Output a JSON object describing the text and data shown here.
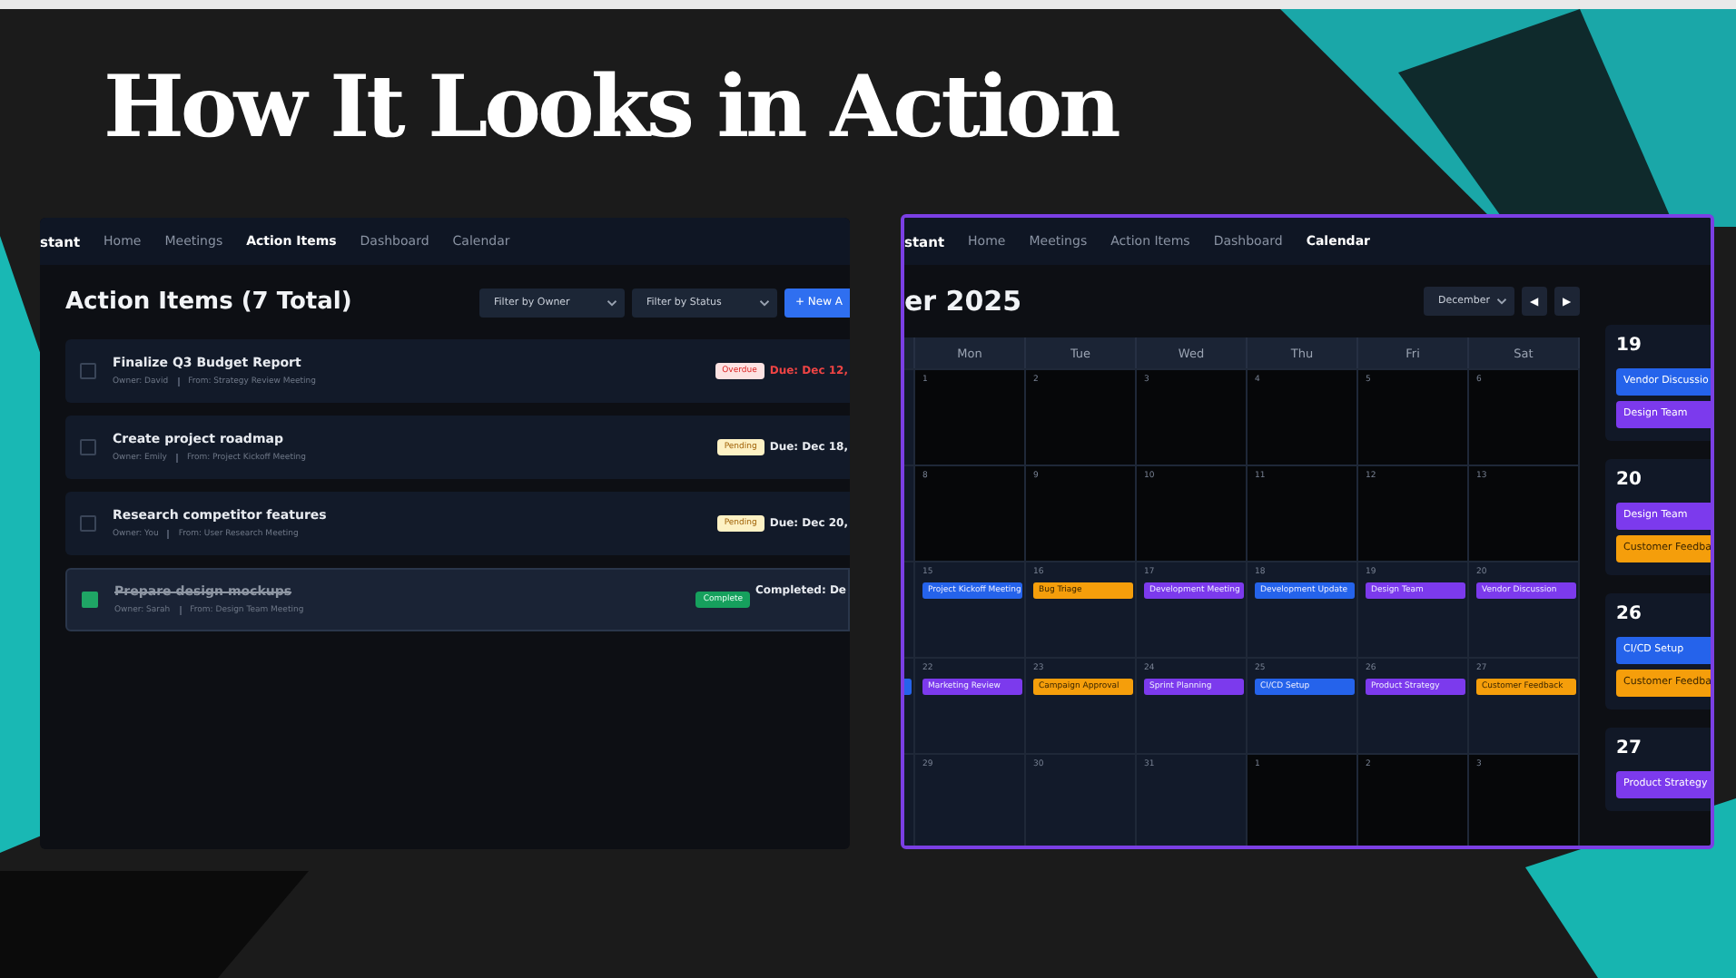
{
  "slide_title": "How It Looks in Action",
  "action_items_screen": {
    "nav": [
      {
        "label": "stant",
        "kind": "brand"
      },
      {
        "label": "Home",
        "kind": "link",
        "selected": false
      },
      {
        "label": "Meetings",
        "kind": "link",
        "selected": false
      },
      {
        "label": "Action Items",
        "kind": "link",
        "selected": true
      },
      {
        "label": "Dashboard",
        "kind": "link",
        "selected": false
      },
      {
        "label": "Calendar",
        "kind": "link",
        "selected": false
      }
    ],
    "title": "Action Items (7 Total)",
    "filters": [
      "Filter by Owner",
      "Filter by Status"
    ],
    "new_button": "+ New A",
    "items": [
      {
        "title": "Finalize Q3 Budget Report",
        "owner": "Owner: David",
        "source": "From: Strategy Review Meeting",
        "badge": "Overdue",
        "kind": "overdue",
        "due": "Due: Dec 12,",
        "checked": false
      },
      {
        "title": "Create project roadmap",
        "owner": "Owner: Emily",
        "source": "From: Project Kickoff Meeting",
        "badge": "Pending",
        "kind": "pending",
        "due": "Due: Dec 18,",
        "checked": false
      },
      {
        "title": "Research competitor features",
        "owner": "Owner: You",
        "source": "From: User Research Meeting",
        "badge": "Pending",
        "kind": "pending",
        "due": "Due: Dec 20,",
        "checked": false
      },
      {
        "title": "Prepare design mockups",
        "owner": "Owner: Sarah",
        "source": "From: Design Team Meeting",
        "badge": "Complete",
        "kind": "complete",
        "due": "Completed: De",
        "checked": true
      }
    ]
  },
  "calendar_screen": {
    "nav": [
      {
        "label": "stant",
        "kind": "brand"
      },
      {
        "label": "Home",
        "kind": "link",
        "selected": false
      },
      {
        "label": "Meetings",
        "kind": "link",
        "selected": false
      },
      {
        "label": "Action Items",
        "kind": "link",
        "selected": false
      },
      {
        "label": "Dashboard",
        "kind": "link",
        "selected": false
      },
      {
        "label": "Calendar",
        "kind": "link",
        "selected": true
      }
    ],
    "title": "er 2025",
    "month_select": "December",
    "prev_button": "◀",
    "next_button": "▶",
    "weekdays": [
      "Mon",
      "Tue",
      "Wed",
      "Thu",
      "Fri",
      "Sat"
    ],
    "weeks": [
      {
        "days": [
          {
            "num": "1",
            "dimmed": true
          },
          {
            "num": "2",
            "dimmed": true
          },
          {
            "num": "3",
            "dimmed": true
          },
          {
            "num": "4",
            "dimmed": true
          },
          {
            "num": "5",
            "dimmed": true
          },
          {
            "num": "6",
            "dimmed": true
          }
        ]
      },
      {
        "days": [
          {
            "num": "8",
            "dimmed": true
          },
          {
            "num": "9",
            "dimmed": true
          },
          {
            "num": "10",
            "dimmed": true
          },
          {
            "num": "11",
            "dimmed": true
          },
          {
            "num": "12",
            "dimmed": true
          },
          {
            "num": "13",
            "dimmed": true
          }
        ]
      },
      {
        "days": [
          {
            "num": "15",
            "dimmed": false,
            "events": [
              {
                "title": "Project Kickoff Meeting",
                "color": "#2563eb"
              }
            ]
          },
          {
            "num": "16",
            "dimmed": false,
            "events": [
              {
                "title": "Bug Triage",
                "color": "#f59e0b"
              }
            ]
          },
          {
            "num": "17",
            "dimmed": false,
            "events": [
              {
                "title": "Development Meeting",
                "color": "#7c3aed"
              }
            ]
          },
          {
            "num": "18",
            "dimmed": false,
            "events": [
              {
                "title": "Development Update",
                "color": "#2563eb"
              }
            ]
          },
          {
            "num": "19",
            "dimmed": false,
            "events": [
              {
                "title": "Design Team",
                "color": "#7c3aed"
              }
            ]
          },
          {
            "num": "20",
            "dimmed": false,
            "events": [
              {
                "title": "Vendor Discussion",
                "color": "#7c3aed"
              }
            ]
          }
        ]
      },
      {
        "cut_event": {
          "color": "#2563eb"
        },
        "days": [
          {
            "num": "22",
            "dimmed": false,
            "events": [
              {
                "title": "Marketing Review",
                "color": "#7c3aed"
              }
            ]
          },
          {
            "num": "23",
            "dimmed": false,
            "events": [
              {
                "title": "Campaign Approval",
                "color": "#f59e0b"
              }
            ]
          },
          {
            "num": "24",
            "dimmed": false,
            "events": [
              {
                "title": "Sprint Planning",
                "color": "#7c3aed"
              }
            ]
          },
          {
            "num": "25",
            "dimmed": false,
            "events": [
              {
                "title": "CI/CD Setup",
                "color": "#2563eb"
              }
            ]
          },
          {
            "num": "26",
            "dimmed": false,
            "events": [
              {
                "title": "Product Strategy",
                "color": "#7c3aed"
              }
            ]
          },
          {
            "num": "27",
            "dimmed": false,
            "events": [
              {
                "title": "Customer Feedback",
                "color": "#f59e0b"
              }
            ]
          }
        ]
      },
      {
        "days": [
          {
            "num": "29",
            "dimmed": false
          },
          {
            "num": "30",
            "dimmed": false
          },
          {
            "num": "31",
            "dimmed": false
          },
          {
            "num": "1",
            "dimmed": true
          },
          {
            "num": "2",
            "dimmed": true
          },
          {
            "num": "3",
            "dimmed": true
          }
        ]
      }
    ],
    "agenda": [
      {
        "day": "19",
        "events": [
          {
            "title": "Vendor Discussio",
            "color": "#2563eb"
          },
          {
            "title": "Design Team",
            "color": "#7c3aed"
          }
        ]
      },
      {
        "day": "20",
        "events": [
          {
            "title": "Design Team",
            "color": "#7c3aed"
          },
          {
            "title": "Customer Feedba",
            "color": "#f59e0b"
          }
        ]
      },
      {
        "day": "26",
        "events": [
          {
            "title": "CI/CD Setup",
            "color": "#2563eb"
          },
          {
            "title": "Customer Feedba",
            "color": "#f59e0b"
          }
        ]
      },
      {
        "day": "27",
        "events": [
          {
            "title": "Product Strategy",
            "color": "#7c3aed"
          }
        ]
      }
    ]
  }
}
